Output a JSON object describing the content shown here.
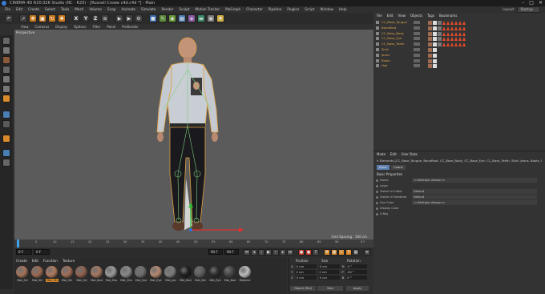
{
  "title": "CINEMA 4D R20.026 Studio (RC - R20) - [Russell Crowe c4d.c4d *] - Main",
  "window_controls": [
    "–",
    "□",
    "✕"
  ],
  "menu": [
    "File",
    "Edit",
    "Create",
    "Select",
    "Tools",
    "Mesh",
    "Volume",
    "Snap",
    "Animate",
    "Simulate",
    "Render",
    "Sculpt",
    "Motion Tracker",
    "MoGraph",
    "Character",
    "Pipeline",
    "Plugins",
    "Script",
    "Window",
    "Help"
  ],
  "layout": {
    "label": "Layout:",
    "value": "Startup"
  },
  "viewport_menu": [
    "View",
    "Cameras",
    "Display",
    "Options",
    "Filter",
    "Panel",
    "ProRender"
  ],
  "viewport_label": "Perspective",
  "grid_spacing": "Grid Spacing : 100 cm",
  "toolbar_axes": [
    "X",
    "Y",
    "Z"
  ],
  "timeline_ticks": [
    "0",
    "5",
    "10",
    "15",
    "20",
    "25",
    "30",
    "35",
    "40",
    "45",
    "50",
    "55",
    "60",
    "65",
    "70",
    "75",
    "80",
    "85",
    "90"
  ],
  "timeline_end": "0 F",
  "playback": {
    "current": "0 F",
    "start": "0 F",
    "end": "90 F",
    "max": "90 F"
  },
  "materials": {
    "menu": [
      "Create",
      "Edit",
      "Function",
      "Texture"
    ],
    "items": [
      {
        "label": "Mat_Ski",
        "color": "#a5735a"
      },
      {
        "label": "Mat_Ski",
        "color": "#9c6a52"
      },
      {
        "label": "Mat_Ski",
        "color": "#b07a5e",
        "selected": true
      },
      {
        "label": "Mat_Ski",
        "color": "#a06e57"
      },
      {
        "label": "Mat_Ski",
        "color": "#8e614c"
      },
      {
        "label": "Mat_Bod",
        "color": "#a67860"
      },
      {
        "label": "Mat_Sho",
        "color": "#9a9a9a"
      },
      {
        "label": "Mat_Sho",
        "color": "#8a8a8a"
      },
      {
        "label": "Mat_Eye",
        "color": "#6f6f6f"
      },
      {
        "label": "Mat_Eye",
        "color": "#b58a72"
      },
      {
        "label": "Mat_Jea",
        "color": "#7d7d7d"
      },
      {
        "label": "Mat_Bod",
        "color": "#1d1d1d"
      },
      {
        "label": "Mat_Bel",
        "color": "#5c5c5c"
      },
      {
        "label": "Mat_Eye",
        "color": "#2a2a2a"
      },
      {
        "label": "Mat_Bod",
        "color": "#444444"
      },
      {
        "label": "Material",
        "color": "#bcbcbc"
      }
    ]
  },
  "coords": {
    "headers": [
      "Position",
      "Size",
      "Rotation"
    ],
    "rows": [
      {
        "axis": "X",
        "pos": "0 cm",
        "size": "0 cm",
        "rot_axis": "H",
        "rot": "0 °"
      },
      {
        "axis": "Y",
        "pos": "0 cm",
        "size": "0 cm",
        "rot_axis": "P",
        "rot": "-90 °"
      },
      {
        "axis": "Z",
        "pos": "0 cm",
        "size": "0 cm",
        "rot_axis": "B",
        "rot": "0 °"
      }
    ],
    "object_mode": "Object (Rel)",
    "size_mode": "Size",
    "apply": "Apply"
  },
  "objects": {
    "menu": [
      "File",
      "Edit",
      "View",
      "Objects",
      "Tags",
      "Bookmarks"
    ],
    "items": [
      "CC_Base_Tongue",
      "BoneRoot",
      "CC_Base_Body",
      "CC_Base_Eye",
      "CC_Base_Teeth",
      "Shirt",
      "Jeans",
      "Boots",
      "Hair"
    ]
  },
  "attributes": {
    "menu": [
      "Mode",
      "Edit",
      "User Data"
    ],
    "title": "9 Elements [CC_Base_Tongue, BoneRoot, CC_Base_Body, CC_Base_Eye, CC_Base_Teeth, Shirt, Jeans, Boots, Hair]",
    "tabs": [
      "Basic",
      "Coord."
    ],
    "section": "Basic Properties",
    "rows": [
      {
        "k": "Name",
        "v": "<<Multiple Values>>"
      },
      {
        "k": "Layer",
        "v": ""
      },
      {
        "k": "Visible in Editor",
        "v": "Default"
      },
      {
        "k": "Visible in Renderer",
        "v": "Default"
      },
      {
        "k": "Use Color",
        "v": "<<Multiple Values>>"
      },
      {
        "k": "Display Color",
        "v": ""
      },
      {
        "k": "X-Ray",
        "v": ""
      }
    ]
  }
}
